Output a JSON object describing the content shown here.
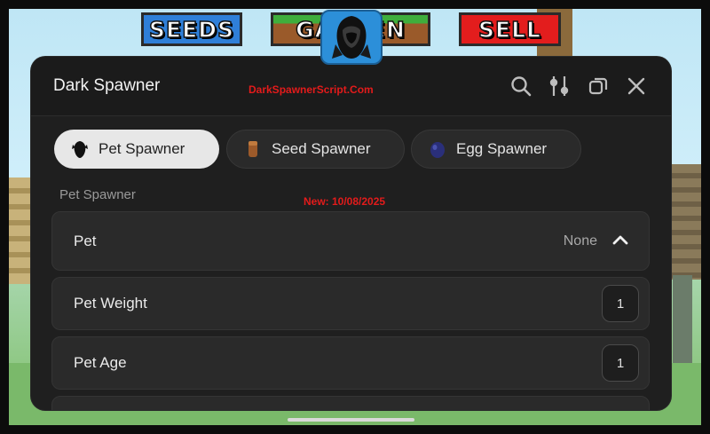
{
  "game": {
    "seeds_label": "SEEDS",
    "garden_label": "GARDEN",
    "sell_label": "SELL"
  },
  "panel": {
    "title": "Dark Spawner",
    "watermark": "DarkSpawnerScript.Com",
    "header_icons": [
      "search-icon",
      "sliders-icon",
      "duplicate-icon",
      "close-icon"
    ]
  },
  "tabs": [
    {
      "label": "Pet Spawner",
      "icon": "pet-icon",
      "active": true
    },
    {
      "label": "Seed Spawner",
      "icon": "seed-icon",
      "active": false
    },
    {
      "label": "Egg Spawner",
      "icon": "egg-icon",
      "active": false
    }
  ],
  "section": {
    "title": "Pet Spawner",
    "notice": "New: 10/08/2025"
  },
  "rows": {
    "pet": {
      "label": "Pet",
      "value": "None"
    },
    "weight": {
      "label": "Pet Weight",
      "value": "1"
    },
    "age": {
      "label": "Pet Age",
      "value": "1"
    }
  },
  "colors": {
    "panel_bg": "#1f1f1f",
    "accent_red": "#e31b1b",
    "tab_active_bg": "#e7e7e7"
  }
}
